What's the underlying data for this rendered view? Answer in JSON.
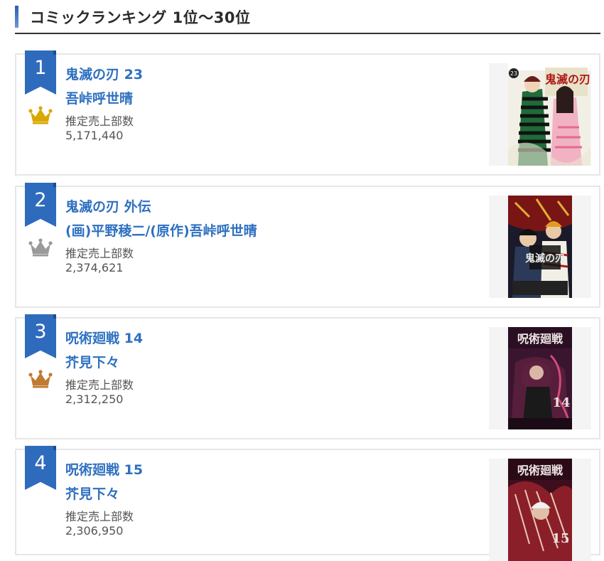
{
  "heading": {
    "title": "コミックランキング 1位〜30位",
    "accent_color": "#2f6bbd"
  },
  "colors": {
    "link": "#2e70c0",
    "rank_flag": "#2f6bbd",
    "gold": "#d9a800",
    "silver": "#9a9a9a",
    "bronze": "#c07a32"
  },
  "sales_label": "推定売上部数",
  "items": [
    {
      "rank": "1",
      "crown": "gold-crown-icon",
      "title": "鬼滅の刃 23",
      "author": "吾峠呼世晴",
      "sales_label": "推定売上部数",
      "sales": "5,171,440",
      "cover_title": "鬼滅の刃",
      "cover_volume": "23",
      "cover_theme": "light"
    },
    {
      "rank": "2",
      "crown": "silver-crown-icon",
      "title": "鬼滅の刃 外伝",
      "author": "(画)平野稜二/(原作)吾峠呼世晴",
      "sales_label": "推定売上部数",
      "sales": "2,374,621",
      "cover_title": "鬼滅の刃",
      "cover_volume": "",
      "cover_theme": "dark"
    },
    {
      "rank": "3",
      "crown": "bronze-crown-icon",
      "title": "呪術廻戦 14",
      "author": "芥見下々",
      "sales_label": "推定売上部数",
      "sales": "2,312,250",
      "cover_title": "呪術廻戦",
      "cover_volume": "14",
      "cover_theme": "jujutsu"
    },
    {
      "rank": "4",
      "crown": "",
      "title": "呪術廻戦 15",
      "author": "芥見下々",
      "sales_label": "推定売上部数",
      "sales": "2,306,950",
      "cover_title": "呪術廻戦",
      "cover_volume": "15",
      "cover_theme": "jujutsu"
    }
  ]
}
